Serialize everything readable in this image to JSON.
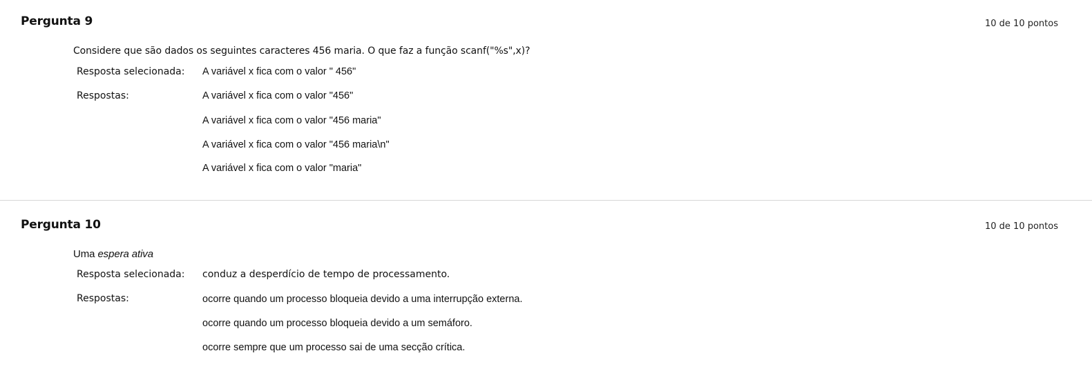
{
  "questions": [
    {
      "title": "Pergunta 9",
      "points": "10 de 10 pontos",
      "text": "Considere que são dados os seguintes caracteres 456 maria. O que faz a função scanf(\"%s\",x)?",
      "selected_label": "Resposta selecionada:",
      "selected_answer": "A variável x fica com o valor \" 456\"",
      "answers_label": "Respostas:",
      "answers": [
        "A variável x fica com o valor \"456\"",
        "A variável x fica com o valor \"456 maria\"",
        "A variável x fica com o valor \"456 maria\\n\"",
        "A variável x fica com o valor \"maria\""
      ]
    },
    {
      "title": "Pergunta 10",
      "points": "10 de 10 pontos",
      "text_prefix": "Uma ",
      "text_emphasis": "espera ativa",
      "selected_label": "Resposta selecionada:",
      "selected_answer": "conduz a desperdício de tempo de processamento.",
      "answers_label": "Respostas:",
      "answers": [
        "ocorre quando um processo bloqueia devido a uma interrupção externa.",
        "ocorre quando um processo bloqueia devido a um semáforo.",
        "ocorre sempre que um processo sai de uma secção crítica."
      ]
    }
  ]
}
